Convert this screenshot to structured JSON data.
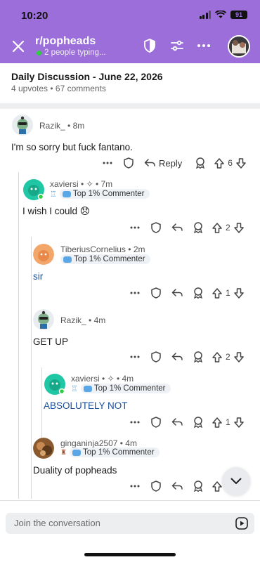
{
  "status": {
    "time": "10:20",
    "battery": "91"
  },
  "header": {
    "title": "r/popheads",
    "typing": "2 people typing..."
  },
  "post": {
    "title": "Daily Discussion - June 22, 2026",
    "meta": "4 upvotes • 67 comments"
  },
  "comments": [
    {
      "user": "Razik_",
      "meta": "• 8m",
      "flair": "",
      "body": "I'm so sorry but fuck fantano.",
      "reply_label": "Reply",
      "score": "6"
    },
    {
      "user": "xaviersi",
      "meta": "• ✧ • 7m",
      "flair": "Top 1% Commenter",
      "body": "I wish I could 😞",
      "score": "2"
    },
    {
      "user": "TiberiusCornelius",
      "meta": "• 2m",
      "flair": "Top 1% Commenter",
      "body": "sir",
      "score": "1"
    },
    {
      "user": "Razik_",
      "meta": "• 4m",
      "flair": "",
      "body": "GET UP",
      "score": "2"
    },
    {
      "user": "xaviersi",
      "meta": "• ✧ • 4m",
      "flair": "Top 1% Commenter",
      "body": "ABSOLUTELY NOT",
      "score": "1"
    },
    {
      "user": "ginganinja2507",
      "meta": "• 4m",
      "flair": "Top 1% Commenter",
      "body": "Duality of popheads",
      "score": ""
    }
  ],
  "composer": {
    "placeholder": "Join the conversation"
  },
  "colors": {
    "header": "#9b6ed9",
    "link_text": "#1a4f9c",
    "online": "#2ecc40"
  }
}
